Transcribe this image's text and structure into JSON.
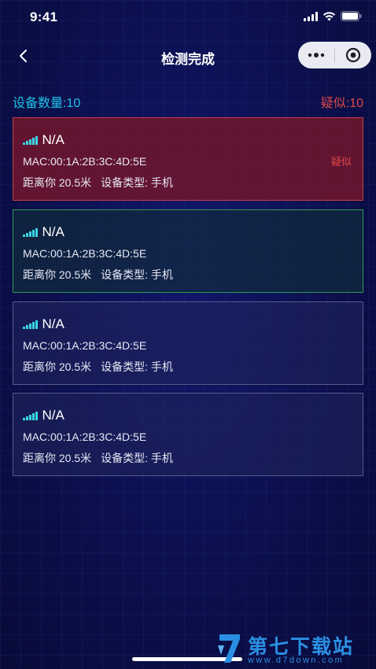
{
  "status_bar": {
    "time": "9:41"
  },
  "nav": {
    "title": "检测完成"
  },
  "summary": {
    "device_count": "设备数量:10",
    "suspect_count": "疑似:10"
  },
  "devices": [
    {
      "name": "N/A",
      "mac": "MAC:00:1A:2B:3C:4D:5E",
      "distance": "距离你 20.5米",
      "type": "设备类型: 手机",
      "status": "suspect",
      "flag": "疑似"
    },
    {
      "name": "N/A",
      "mac": "MAC:00:1A:2B:3C:4D:5E",
      "distance": "距离你 20.5米",
      "type": "设备类型: 手机",
      "status": "safe"
    },
    {
      "name": "N/A",
      "mac": "MAC:00:1A:2B:3C:4D:5E",
      "distance": "距离你 20.5米",
      "type": "设备类型: 手机",
      "status": "normal"
    },
    {
      "name": "N/A",
      "mac": "MAC:00:1A:2B:3C:4D:5E",
      "distance": "距离你 20.5米",
      "type": "设备类型: 手机",
      "status": "normal"
    }
  ],
  "watermark": {
    "brand": "第七下载站",
    "url": "www.d7down.com"
  },
  "icons": {
    "back": "chevron-left-icon",
    "more": "more-dots-icon",
    "close": "target-circle-icon",
    "signal": "signal-strength-icon"
  },
  "colors": {
    "accent": "#1ec2e8",
    "danger": "#e24848",
    "safe": "#2f9a52",
    "background": "#0b1048"
  }
}
